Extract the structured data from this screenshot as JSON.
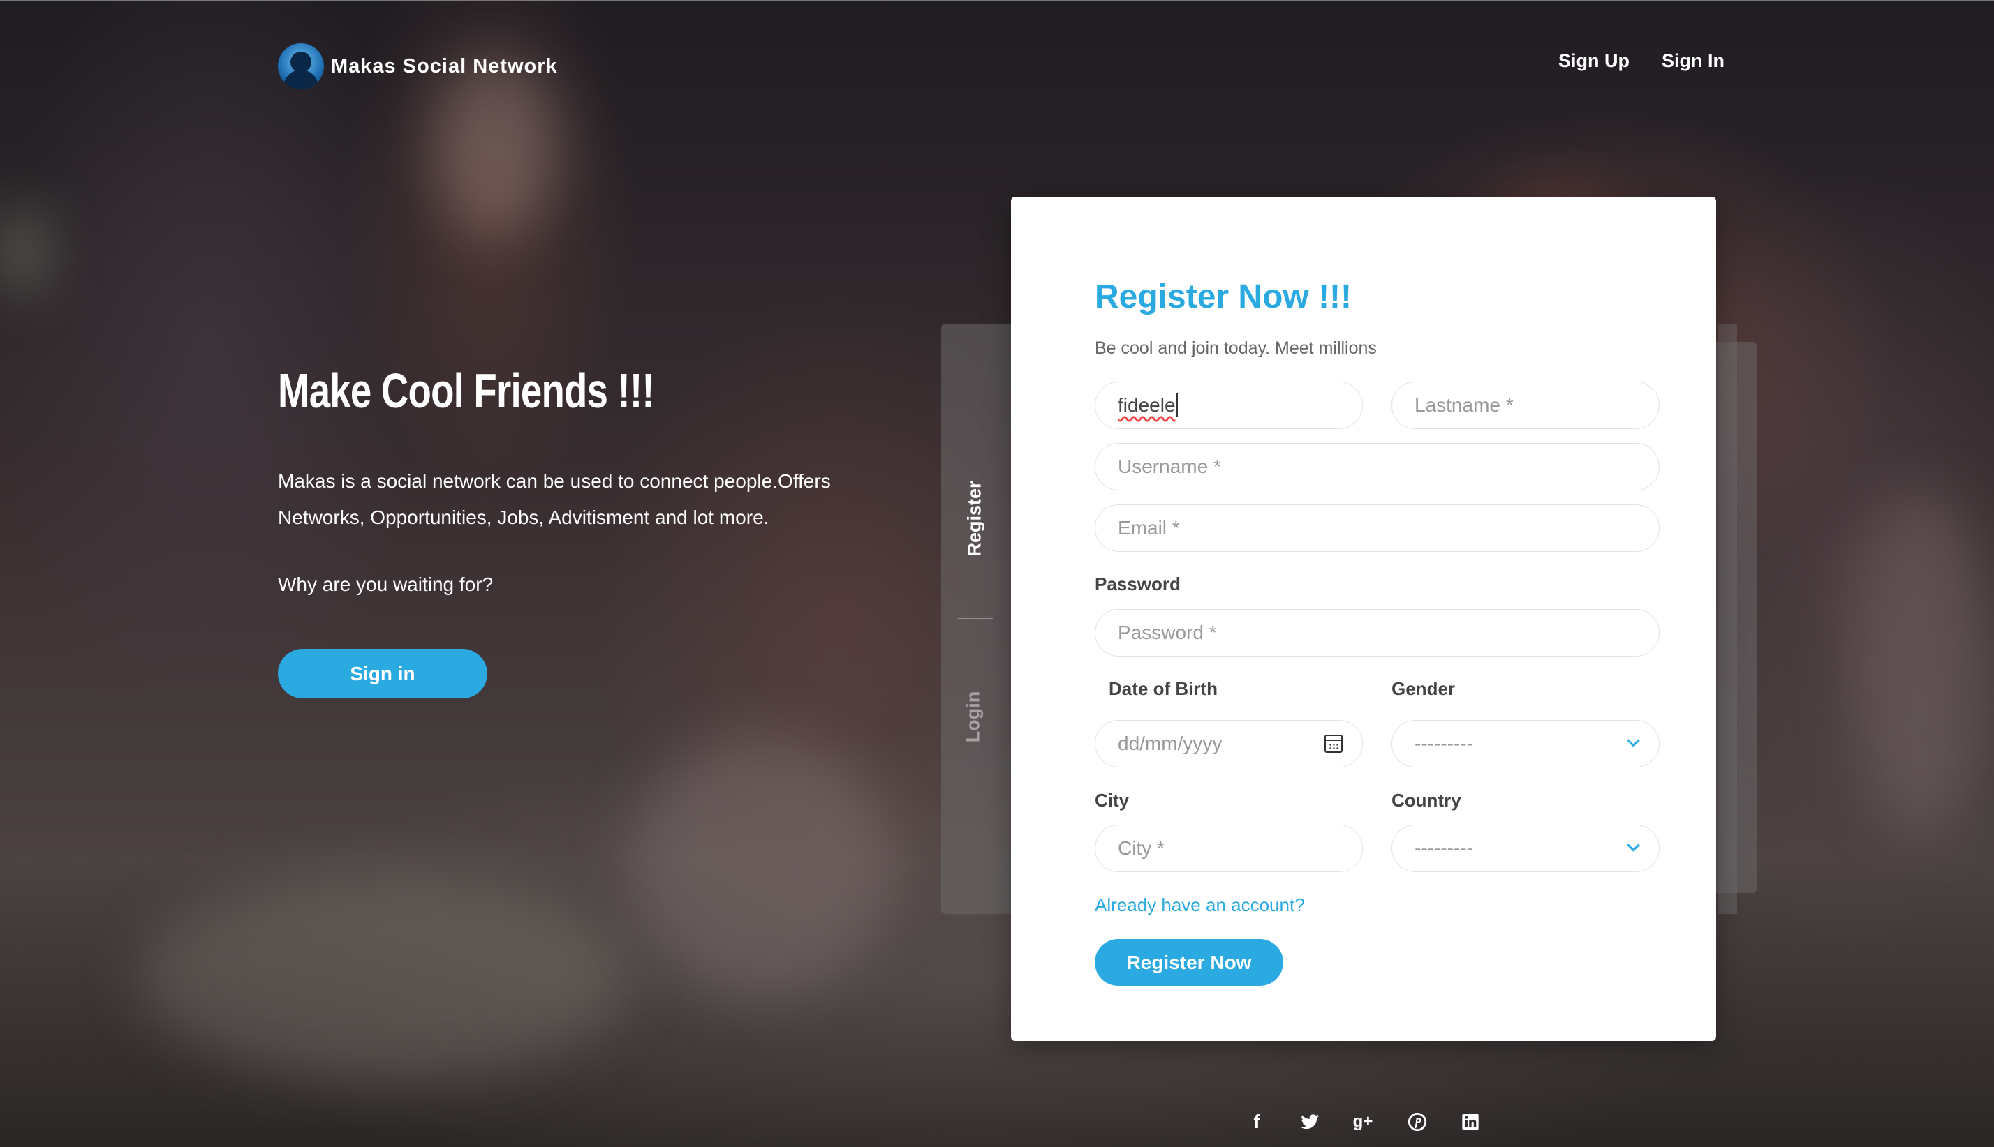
{
  "brand": {
    "name": "Makas Social Network"
  },
  "nav": {
    "signup": "Sign Up",
    "signin": "Sign In"
  },
  "hero": {
    "title": "Make Cool Friends !!!",
    "text": "Makas is a social network can be used to connect people.Offers Networks, Opportunities, Jobs, Advitisment and lot more.",
    "question": "Why are you waiting for?",
    "button": "Sign in"
  },
  "side_tabs": {
    "register": "Register",
    "login": "Login"
  },
  "form": {
    "title": "Register Now !!!",
    "subtitle": "Be cool and join today. Meet millions",
    "firstname_value": "fideele",
    "lastname_placeholder": "Lastname *",
    "username_placeholder": "Username *",
    "email_placeholder": "Email *",
    "password_label": "Password",
    "password_placeholder": "Password *",
    "dob_label": "Date of Birth",
    "dob_placeholder": "dd/mm/yyyy",
    "gender_label": "Gender",
    "gender_selected": "---------",
    "city_label": "City",
    "city_placeholder": "City *",
    "country_label": "Country",
    "country_selected": "---------",
    "account_link": "Already have an account?",
    "submit": "Register Now"
  },
  "social": {
    "facebook": "f",
    "googleplus": "g+"
  },
  "colors": {
    "accent": "#2ba9e1"
  },
  "icons": [
    "facebook-icon",
    "twitter-icon",
    "google-plus-icon",
    "pinterest-icon",
    "linkedin-icon",
    "calendar-icon",
    "chevron-down-icon"
  ]
}
